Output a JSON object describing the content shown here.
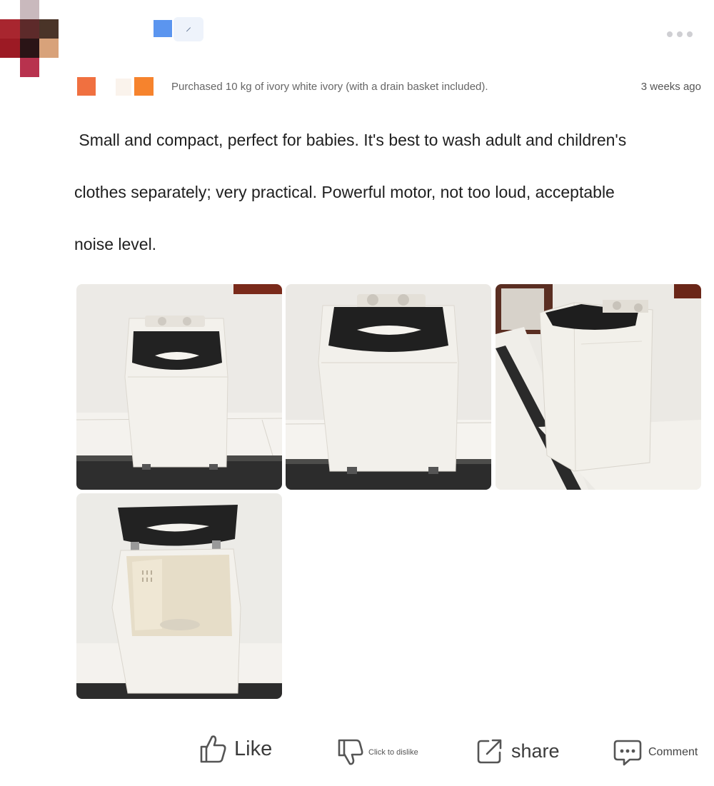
{
  "header": {
    "badge_glyph": "⸝",
    "more_icon": "ellipsis-icon"
  },
  "purchase_info": "Purchased 10 kg of ivory white ivory (with a drain basket included).",
  "timestamp": "3 weeks ago",
  "review_text": " Small and compact, perfect for babies. It's best to wash adult and children's\nclothes separately; very practical. Powerful motor, not too loud, acceptable\nnoise level.",
  "photos": [
    {
      "subject": "washing-machine-front-closed"
    },
    {
      "subject": "washing-machine-closeup-closed"
    },
    {
      "subject": "washing-machine-side-view"
    },
    {
      "subject": "washing-machine-lid-open"
    }
  ],
  "actions": {
    "like_label": "Like",
    "dislike_label": "Click to dislike",
    "share_label": "share",
    "comment_label": "Comment"
  },
  "colors": {
    "accent_blue": "#5b95ef",
    "tag_orange": "#f6832d",
    "icon_gray": "#555555"
  }
}
